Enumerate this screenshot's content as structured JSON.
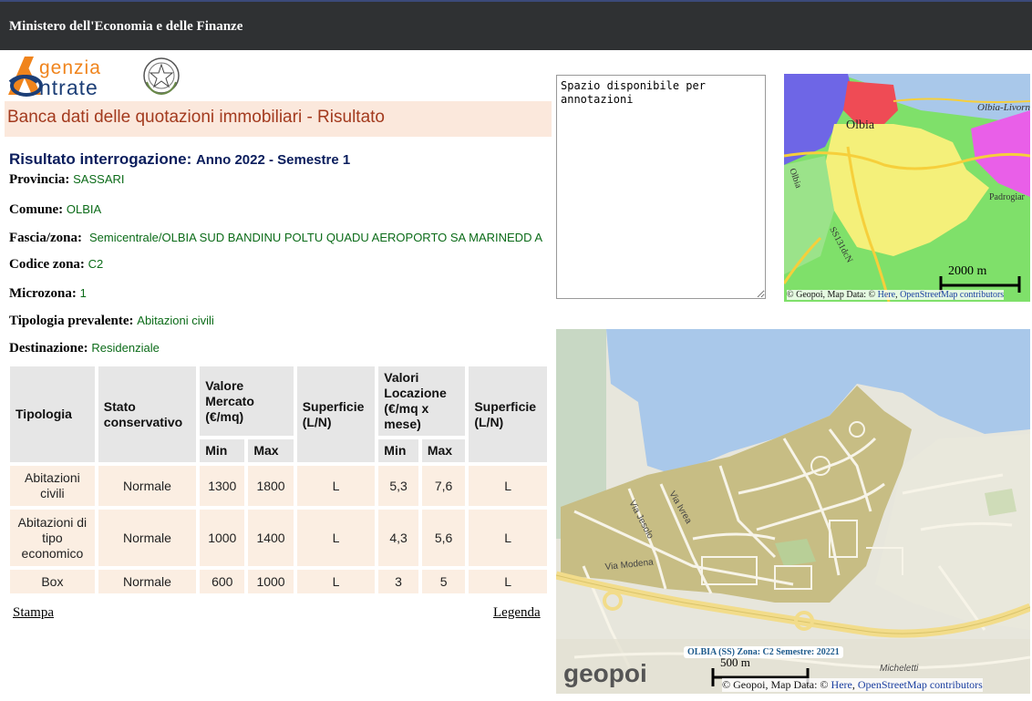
{
  "header": {
    "title": "Ministero dell'Economia e delle Finanze"
  },
  "logo": {
    "line1": "genzia",
    "line2": "ntrate"
  },
  "banner": {
    "title": "Banca dati delle quotazioni immobiliari - Risultato"
  },
  "result": {
    "label": "Risultato interrogazione:",
    "period": "Anno 2022 - Semestre 1",
    "provincia_label": "Provincia:",
    "provincia": "SASSARI",
    "comune_label": "Comune:",
    "comune": "OLBIA",
    "fascia_label": "Fascia/zona:",
    "fascia": "Semicentrale/OLBIA SUD BANDINU POLTU QUADU AEROPORTO SA MARINEDD A",
    "codice_label": "Codice zona:",
    "codice": "C2",
    "microzona_label": "Microzona:",
    "microzona": "1",
    "tipologia_label": "Tipologia prevalente:",
    "tipologia": "Abitazioni civili",
    "destinazione_label": "Destinazione:",
    "destinazione": "Residenziale"
  },
  "table": {
    "headers": {
      "tipologia": "Tipologia",
      "stato": "Stato conservativo",
      "valore": "Valore Mercato (€/mq)",
      "superficie1": "Superficie (L/N)",
      "locazione": "Valori Locazione (€/mq x mese)",
      "superficie2": "Superficie (L/N)",
      "min": "Min",
      "max": "Max"
    },
    "rows": [
      {
        "tipologia": "Abitazioni civili",
        "stato": "Normale",
        "vm_min": "1300",
        "vm_max": "1800",
        "sup1": "L",
        "vl_min": "5,3",
        "vl_max": "7,6",
        "sup2": "L"
      },
      {
        "tipologia": "Abitazioni di tipo economico",
        "stato": "Normale",
        "vm_min": "1000",
        "vm_max": "1400",
        "sup1": "L",
        "vl_min": "4,3",
        "vl_max": "5,6",
        "sup2": "L"
      },
      {
        "tipologia": "Box",
        "stato": "Normale",
        "vm_min": "600",
        "vm_max": "1000",
        "sup1": "L",
        "vl_min": "3",
        "vl_max": "5",
        "sup2": "L"
      }
    ]
  },
  "links": {
    "stampa": "Stampa",
    "legenda": "Legenda"
  },
  "notes": {
    "value": "Spazio disponibile per annotazioni"
  },
  "map_small": {
    "city": "Olbia",
    "road1": "Olbia-Livorno",
    "road2": "Olbia",
    "road3": "SS131dcN",
    "place": "Padrogiar",
    "scale": "2000 m",
    "attribution_prefix": "© Geopoi, Map Data: © ",
    "attribution_here": "Here",
    "attribution_osm": "OpenStreetMap contributors"
  },
  "map_big": {
    "streets": [
      "Via Jesolo",
      "Via Ivrea",
      "Via Modena"
    ],
    "place": "Micheletti",
    "badge": "OLBIA (SS) Zona: C2 Semestre: 20221",
    "scale": "500 m",
    "brand": "geopoi",
    "attribution_prefix": "© Geopoi, Map Data: © ",
    "attribution_here": "Here",
    "attribution_osm": "OpenStreetMap contributors"
  },
  "colors": {
    "topbar": "#2f3133",
    "banner_bg": "#fbe8dc",
    "banner_text": "#a33a1e",
    "value_green": "#0b6b18",
    "table_header": "#e6e6e6",
    "table_cell": "#fbeee2"
  }
}
